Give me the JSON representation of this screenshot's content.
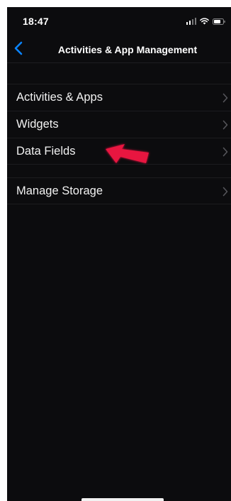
{
  "status_bar": {
    "time": "18:47",
    "signal_icon": "signal-bars-icon",
    "wifi_icon": "wifi-icon",
    "battery_icon": "battery-icon"
  },
  "nav": {
    "back_icon": "chevron-left-icon",
    "title": "Activities & App Management"
  },
  "sections": [
    {
      "items": [
        {
          "label": "Activities & Apps",
          "icon": "chevron-right-icon"
        },
        {
          "label": "Widgets",
          "icon": "chevron-right-icon"
        },
        {
          "label": "Data Fields",
          "icon": "chevron-right-icon"
        }
      ]
    },
    {
      "items": [
        {
          "label": "Manage Storage",
          "icon": "chevron-right-icon"
        }
      ]
    }
  ],
  "annotation": {
    "icon": "pointer-arrow-icon",
    "color": "#e8123f"
  },
  "colors": {
    "background": "#0c0c0e",
    "accent": "#0a84ff",
    "text": "#f2f2f2",
    "chevron": "#55555a"
  }
}
